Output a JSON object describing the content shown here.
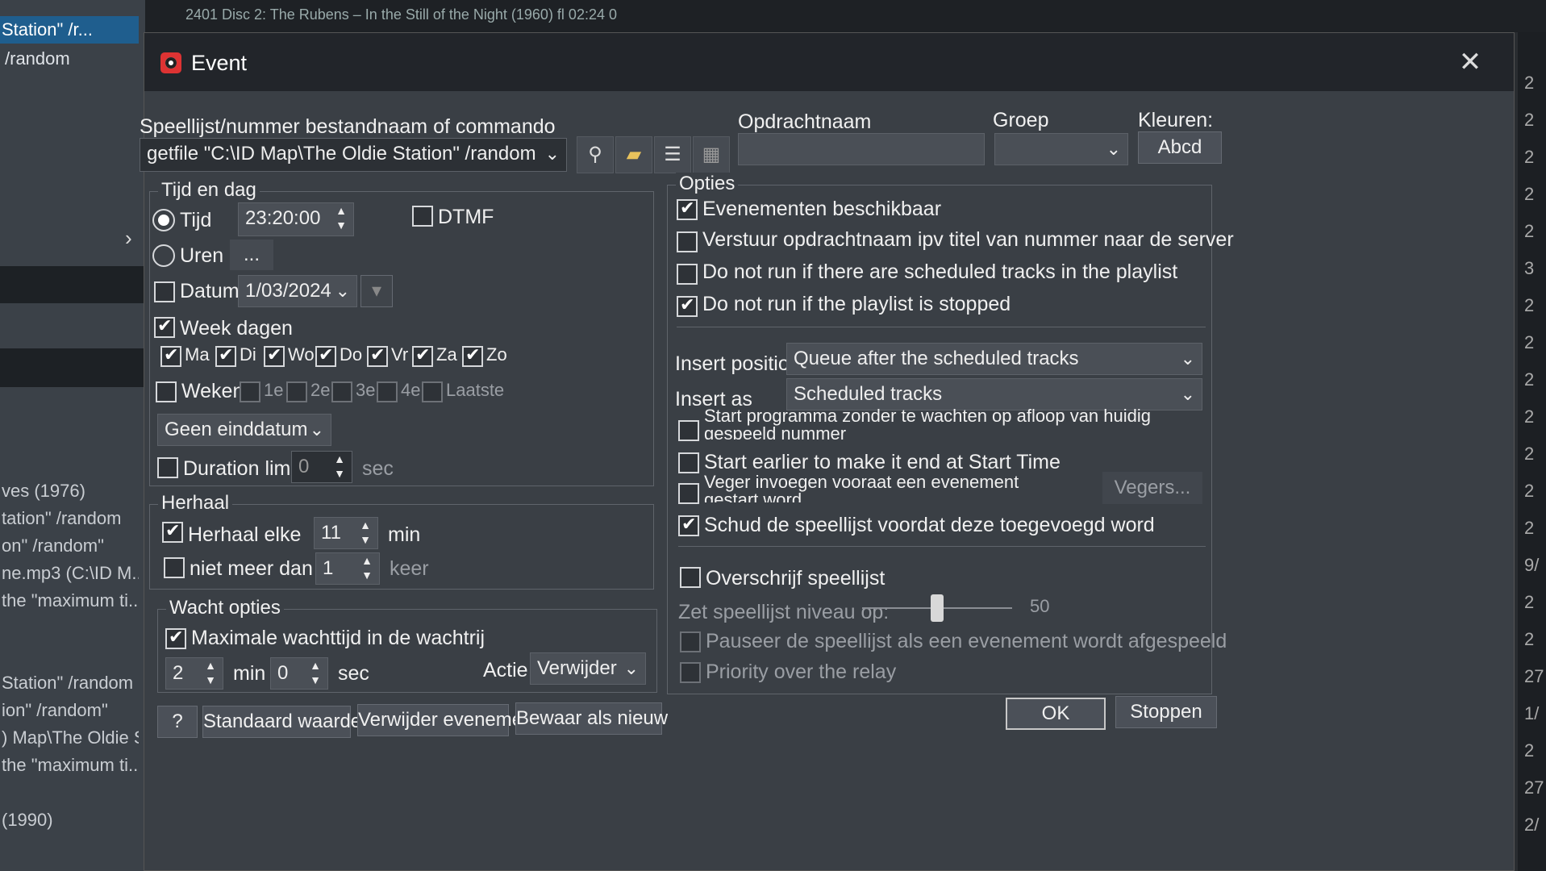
{
  "background": {
    "top_strip_text": "2401   Disc 2: The Rubens – In the Still of the Night (1960) fl   02:24   0",
    "left_items": [
      "Station\" /r...",
      "/random"
    ],
    "left_lines": [
      "ves (1976)",
      "tation\" /random",
      "on\" /random\"",
      "ne.mp3 (C:\\ID M...",
      "the \"maximum ti...",
      "",
      "",
      "Station\" /random",
      "ion\" /random\"",
      ") Map\\The Oldie S...",
      " the \"maximum ti...",
      "",
      "(1990)"
    ],
    "right_numbers": [
      "2",
      "2",
      "2",
      "2",
      "2",
      "3",
      "2",
      "2",
      "2",
      "2",
      "2",
      "2",
      "2",
      "9/",
      "2",
      "2",
      "27",
      "1/",
      "2",
      "27",
      "2/"
    ]
  },
  "dialog": {
    "title": "Event",
    "close_glyph": "✕",
    "command_label": "Speellijst/nummer bestandnaam of commando",
    "command_value": "getfile \"C:\\ID Map\\The Oldie Station\" /random",
    "task_name_label": "Opdrachtnaam",
    "task_name_value": "",
    "group_label": "Groep",
    "group_value": "",
    "colors_label": "Kleuren:",
    "colors_button": "Abcd",
    "tijd_en_dag": {
      "title": "Tijd en dag",
      "tijd_label": "Tijd",
      "tijd_value": "23:20:00",
      "dtmf_label": "DTMF",
      "uren_label": "Uren",
      "uren_button": "...",
      "datum_label": "Datum",
      "datum_value": "1/03/2024",
      "weekdagen_label": "Week dagen",
      "days": [
        "Ma",
        "Di",
        "Wo",
        "Do",
        "Vr",
        "Za",
        "Zo"
      ],
      "weken_label": "Weken",
      "weeks": [
        "1e",
        "2e",
        "3e",
        "4e",
        "Laatste"
      ],
      "end_date_value": "Geen einddatum",
      "duration_label": "Duration limit",
      "duration_value": "0",
      "duration_unit": "sec"
    },
    "herhaal": {
      "title": "Herhaal",
      "repeat_label": "Herhaal elke",
      "repeat_value": "11",
      "repeat_unit": "min",
      "max_label": "niet meer dan",
      "max_value": "1",
      "max_unit": "keer"
    },
    "wacht": {
      "title": "Wacht opties",
      "max_wait_label": "Maximale wachttijd in de wachtrij",
      "min_value": "2",
      "min_unit": "min",
      "sec_value": "0",
      "sec_unit": "sec",
      "action_label": "Actie",
      "action_value": "Verwijder"
    },
    "opties": {
      "title": "Opties",
      "enabled_label": "Evenementen beschikbaar",
      "send_name_label": "Verstuur opdrachtnaam ipv titel van nummer naar de server",
      "no_run_scheduled_label": "Do not run if there are scheduled tracks in the playlist",
      "no_run_stopped_label": "Do not run if the playlist is stopped",
      "insert_position_label": "Insert position",
      "insert_position_value": "Queue after the scheduled tracks",
      "insert_as_label": "Insert as",
      "insert_as_value": "Scheduled tracks",
      "start_immediately_label": "Start programma zonder te wachten op afloop van huidig gespeeld nummer",
      "start_earlier_label": "Start earlier to make it end at Start Time",
      "sweeper_label": "Veger invoegen vooraat een evenement gestart word",
      "sweepers_button": "Vegers...",
      "shuffle_label": "Schud de speellijst voordat deze toegevoegd word",
      "overwrite_label": "Overschrijf speellijst",
      "level_label": "Zet speellijst niveau op:",
      "level_value": "50",
      "level_fraction": 0.5,
      "pause_label": "Pauseer de speellijst als een evenement wordt afgespeeld",
      "priority_label": "Priority over the relay"
    },
    "footer": {
      "help": "?",
      "defaults": "Standaard waarden",
      "delete": "Verwijder evenement",
      "save_new": "Bewaar als nieuw",
      "ok": "OK",
      "stop": "Stoppen"
    },
    "icons": [
      "pin-icon",
      "folder-icon",
      "list-icon",
      "image-icon",
      "chevron-down-icon"
    ]
  }
}
